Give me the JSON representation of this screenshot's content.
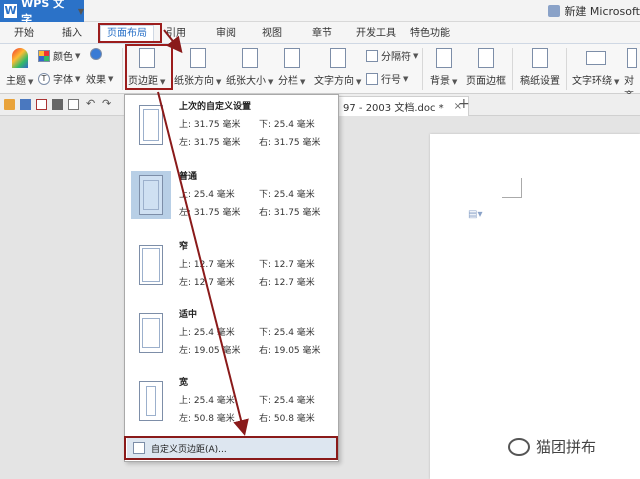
{
  "titlebar": {
    "app_name": "WPS 文字",
    "user": "新建 Microsoft"
  },
  "menu": {
    "tabs": [
      "开始",
      "插入",
      "页面布局",
      "引用",
      "审阅",
      "视图",
      "章节",
      "开发工具",
      "特色功能"
    ],
    "active": "页面布局"
  },
  "ribbon": {
    "theme": "主题",
    "color": "颜色",
    "font": "字体",
    "effect": "效果",
    "page_margin": "页边距",
    "orientation": "纸张方向",
    "size": "纸张大小",
    "columns": "分栏",
    "text_direction": "文字方向",
    "breaks": "分隔符",
    "line_numbers": "行号",
    "background": "背景",
    "page_border": "页面边框",
    "paper_settings": "稿纸设置",
    "wrap": "文字环绕",
    "align": "对齐"
  },
  "doc_tab": {
    "label": "97 - 2003 文档.doc *",
    "close": "×",
    "add": "+"
  },
  "margins_menu": {
    "options": [
      {
        "name": "上次的自定义设置",
        "top": "上: 31.75 毫米",
        "bottom": "下: 25.4 毫米",
        "left": "左: 31.75 毫米",
        "right": "右: 31.75 毫米"
      },
      {
        "name": "普通",
        "top": "上: 25.4 毫米",
        "bottom": "下: 25.4 毫米",
        "left": "左: 31.75 毫米",
        "right": "右: 31.75 毫米"
      },
      {
        "name": "窄",
        "top": "上: 12.7 毫米",
        "bottom": "下: 12.7 毫米",
        "left": "左: 12.7 毫米",
        "right": "右: 12.7 毫米"
      },
      {
        "name": "适中",
        "top": "上: 25.4 毫米",
        "bottom": "下: 25.4 毫米",
        "left": "左: 19.05 毫米",
        "right": "右: 19.05 毫米"
      },
      {
        "name": "宽",
        "top": "上: 25.4 毫米",
        "bottom": "下: 25.4 毫米",
        "left": "左: 50.8 毫米",
        "right": "右: 50.8 毫米"
      }
    ],
    "custom": "自定义页边距(A)..."
  },
  "watermark": "猫团拼布",
  "colors": {
    "accent": "#2b72c8",
    "highlight": "#9c1d1d",
    "selected": "#b8cfe6"
  }
}
